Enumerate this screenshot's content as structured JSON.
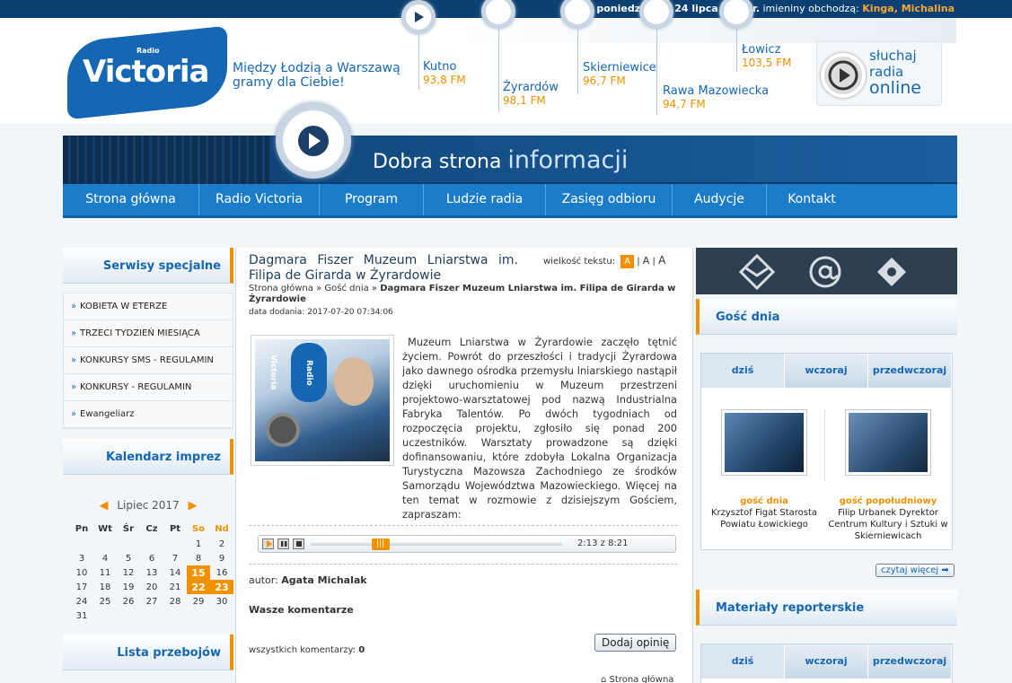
{
  "topbar": {
    "date": "poniedziałek, 24 lipca 2017 r.",
    "names_label": "imieniny obchodzą:",
    "names": "Kinga, Michalina"
  },
  "logo": {
    "radio": "Radio",
    "name": "Victoria",
    "slogan": "Między Łodzią a Warszawą gramy dla Ciebie!"
  },
  "stations": [
    {
      "name": "Kutno",
      "fm": "93,8 FM"
    },
    {
      "name": "Żyrardów",
      "fm": "98,1 FM"
    },
    {
      "name": "Skierniewice",
      "fm": "96,7 FM"
    },
    {
      "name": "Rawa Mazowiecka",
      "fm": "94,7 FM"
    },
    {
      "name": "Łowicz",
      "fm": "103,5 FM"
    }
  ],
  "online": {
    "line1": "słuchaj",
    "line2": "radia",
    "line3": "online"
  },
  "banner": {
    "title1": "Dobra strona",
    "title2": "informacji"
  },
  "nav": [
    "Strona główna",
    "Radio Victoria",
    "Program",
    "Ludzie radia",
    "Zasięg odbioru",
    "Audycje",
    "Kontakt"
  ],
  "left": {
    "special_title": "Serwisy specjalne",
    "special_items": [
      "KOBIETA W ETERZE",
      "TRZECI TYDZIEŃ MIESIĄCA",
      "KONKURSY SMS - REGULAMIN",
      "KONKURSY - REGULAMIN",
      "Ewangeliarz"
    ],
    "calendar_title": "Kalendarz imprez",
    "month": "Lipiec 2017",
    "days": [
      "Pn",
      "Wt",
      "Śr",
      "Cz",
      "Pt",
      "So",
      "Nd"
    ],
    "weeks": [
      [
        "",
        "",
        "",
        "",
        "",
        "1",
        "2"
      ],
      [
        "3",
        "4",
        "5",
        "6",
        "7",
        "8",
        "9"
      ],
      [
        "10",
        "11",
        "12",
        "13",
        "14",
        "15",
        "16"
      ],
      [
        "17",
        "18",
        "19",
        "20",
        "21",
        "22",
        "23"
      ],
      [
        "24",
        "25",
        "26",
        "27",
        "28",
        "29",
        "30"
      ],
      [
        "31",
        "",
        "",
        "",
        "",
        "",
        ""
      ]
    ],
    "hits_title": "Lista przebojów"
  },
  "article": {
    "title": "Dagmara Fiszer Muzeum Lniarstwa im. Filipa de Girarda w Żyrardowie",
    "font_label": "wielkość tekstu:",
    "font_options": [
      "A",
      "A",
      "A"
    ],
    "breadcrumb_home": "Strona główna",
    "breadcrumb_sep": "»",
    "breadcrumb_section": "Gość dnia",
    "breadcrumb_current": "Dagmara Fiszer Muzeum Lniarstwa im. Filipa de Girarda w Żyrardowie",
    "date": "data dodania: 2017-07-20 07:34:06",
    "body": "Muzeum Lniarstwa w Żyrardowie zaczęło tętnić życiem. Powrót do przeszłości i tradycji Żyrardowa jako dawnego ośrodka przemysłu lniarskiego nastąpił dzięki uruchomieniu w Muzeum przestrzeni projektowo-warsztatowej pod nazwą Industrialna Fabryka Talentów. Po dwóch tygodniach od rozpoczęcia projektu, zgłosiło się ponad 200 uczestników. Warsztaty prowadzone są dzięki dofinansowaniu, które zdobyła Lokalna Organizacja Turystyczna Mazowsza Zachodniego ze środków Samorządu Województwa Mazowieckiego. Więcej na ten temat w rozmowie z dzisiejszym Gościem, zapraszam:",
    "player_time": "2:13 z 8:21",
    "player_progress": 0.26,
    "author_label": "autor:",
    "author": "Agata Michalak",
    "comments_title": "Wasze komentarze",
    "add_opinion": "Dodaj opinię",
    "comments_count_label": "wszystkich komentarzy:",
    "comments_count": "0",
    "home_link": "Strona główna",
    "photo_text": "Radio Victoria"
  },
  "right": {
    "guest_title": "Gość dnia",
    "tabs": [
      "dziś",
      "wczoraj",
      "przedwczoraj"
    ],
    "guests": [
      {
        "role": "gość dnia",
        "name": "Krzysztof Figat Starosta Powiatu Łowickiego"
      },
      {
        "role": "gość popołudniowy",
        "name": "Filip Urbanek Dyrektor Centrum Kultury i Sztuki w Skierniewicach"
      }
    ],
    "more": "czytaj więcej",
    "reports_title": "Materiały reporterskie",
    "tabs2": [
      "dziś",
      "wczoraj",
      "przedwczoraj"
    ]
  },
  "colors": {
    "brand": "#1567b4",
    "accent": "#f29100",
    "navy": "#0c3f72"
  }
}
